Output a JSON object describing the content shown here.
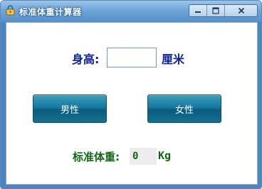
{
  "window": {
    "title": "标准体重计算器",
    "controls": {
      "minimize": "minimize",
      "maximize": "maximize",
      "close": "close"
    }
  },
  "form": {
    "height_label": "身高:",
    "height_value": "",
    "height_unit": "厘米",
    "male_button": "男性",
    "female_button": "女性",
    "result_label": "标准体重:",
    "result_value": "0",
    "result_unit": "Kg"
  },
  "icons": {
    "app": "lock-icon",
    "minimize": "minimize-icon",
    "maximize": "maximize-icon",
    "close": "close-icon"
  },
  "colors": {
    "label_blue": "#0b1e9a",
    "result_green": "#0e6a10",
    "button_teal": "#16789d",
    "title_bar": "#5590cc"
  }
}
